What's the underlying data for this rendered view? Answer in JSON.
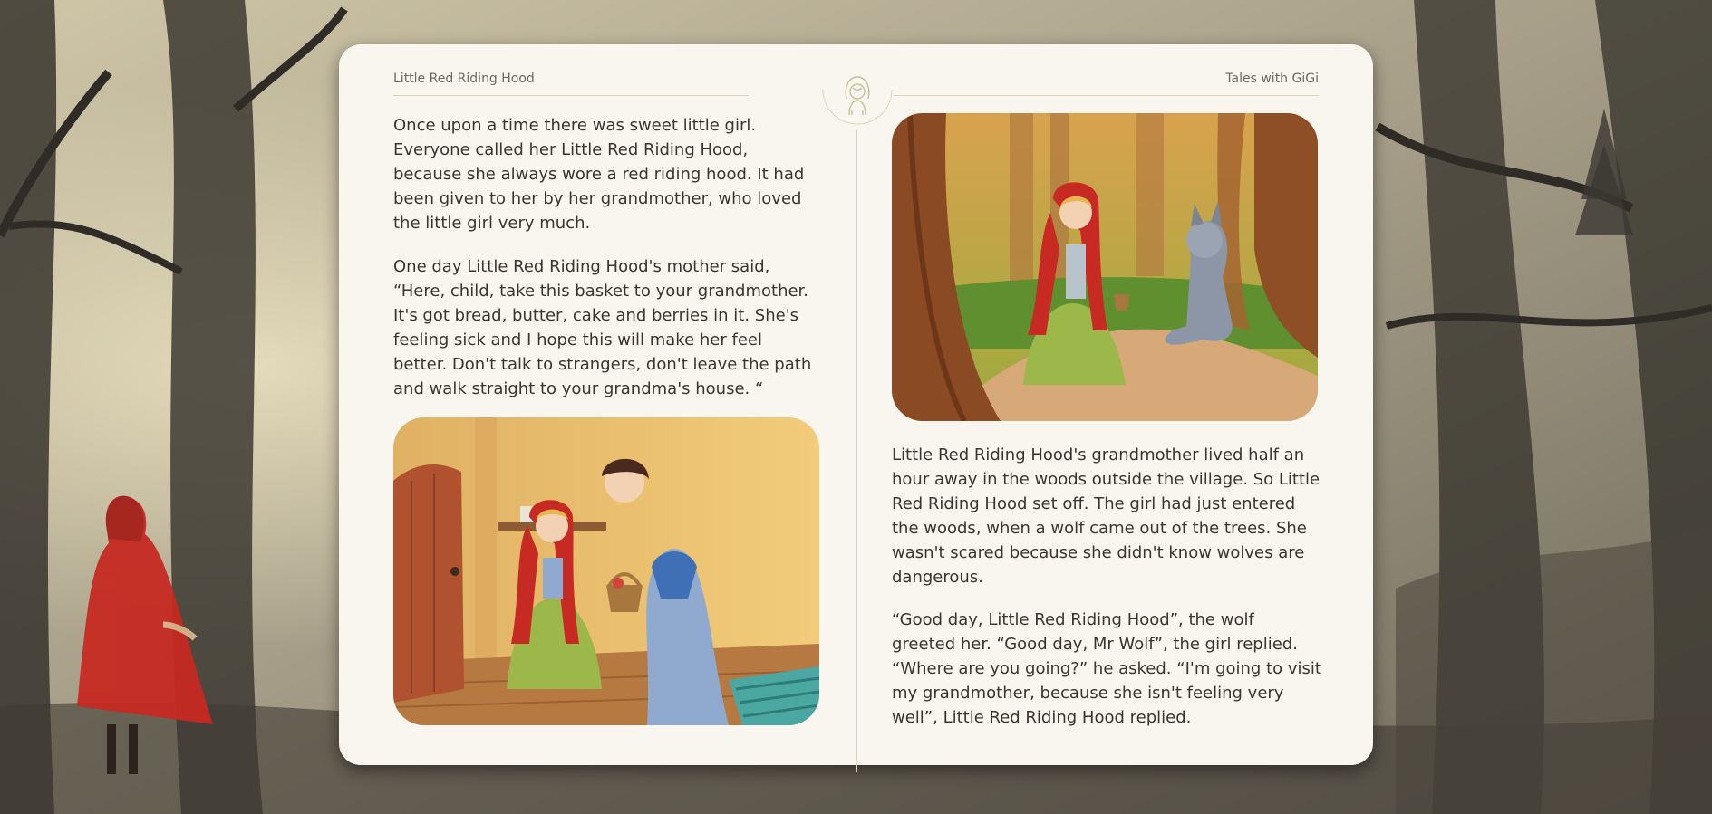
{
  "book": {
    "title": "Little Red Riding Hood",
    "series": "Tales with GiGi"
  },
  "pages": {
    "left": {
      "paragraphs": [
        "Once upon a time there was sweet little girl. Everyone called her Little Red Riding Hood, because she always wore a red riding hood. It had been given to her by her grandmother, who loved the little girl very much.",
        "One day Little Red Riding Hood's mother said, “Here, child, take this basket to your grandmother. It's got bread, butter, cake and berries in it. She's feeling sick and I hope this will make her feel better. Don't talk to strangers, don't leave the path and walk straight to your grandma's house. “"
      ]
    },
    "right": {
      "paragraphs": [
        "Little Red Riding Hood's grandmother lived half an hour away in the woods outside the village. So Little Red Riding Hood set off. The girl had just entered the woods, when a wolf came out of the trees. She wasn't scared because she didn't know wolves are dangerous.",
        "“Good day, Little Red Riding Hood”, the wolf greeted her. “Good day, Mr Wolf”, the girl replied. “Where are you going?” he asked. “I'm going to visit my grandmother, because she isn't feeling very well”, Little Red Riding Hood replied."
      ]
    }
  },
  "colors": {
    "page": "#f8f6ef",
    "text": "#3b372f",
    "rule": "#d9d3b7",
    "riding_hood_red": "#c62a22"
  },
  "icons": {
    "medallion": "girl-portrait-icon"
  }
}
